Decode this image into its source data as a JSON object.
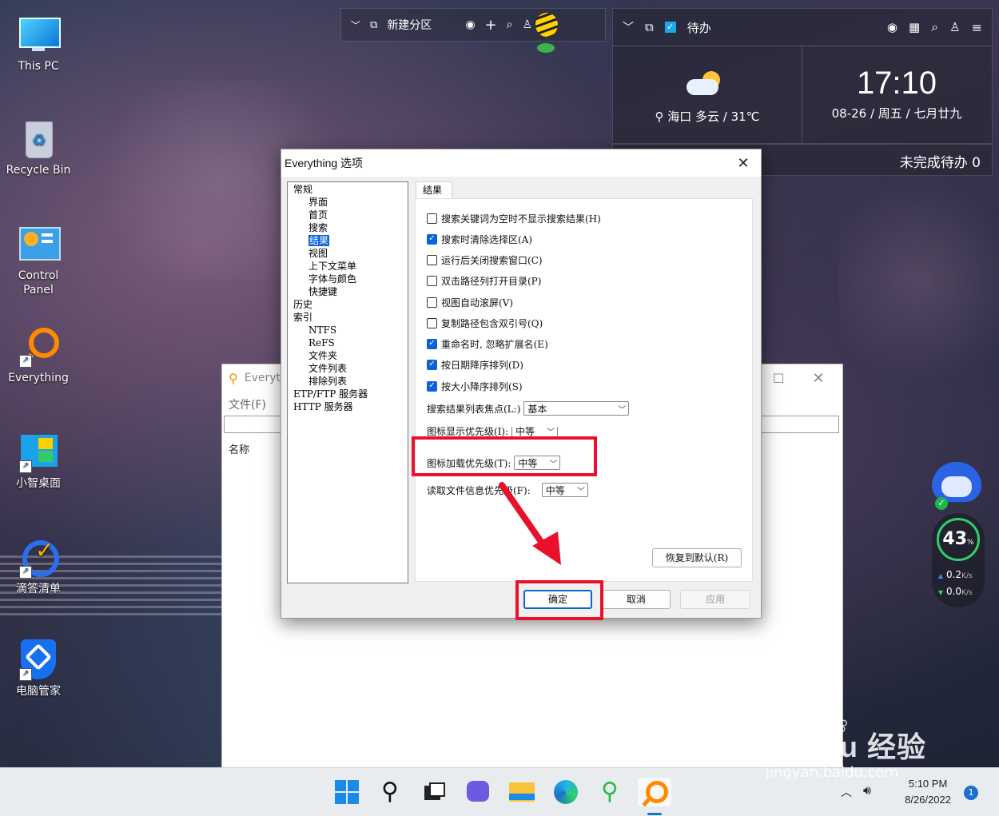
{
  "desktop_icons": [
    {
      "label": "This PC"
    },
    {
      "label": "Recycle Bin"
    },
    {
      "label": "Control Panel"
    },
    {
      "label": "Everything"
    },
    {
      "label": "小智桌面"
    },
    {
      "label": "滴答清单"
    },
    {
      "label": "电脑管家"
    }
  ],
  "widget_partition": {
    "title": "新建分区"
  },
  "widget_todo": {
    "title": "待办",
    "weather": "海口 多云 / 31℃",
    "time": "17:10",
    "date": "08-26 / 周五 / 七月廿九",
    "pending": "未完成待办 0"
  },
  "dialog": {
    "title": "Everything 选项",
    "tree": [
      {
        "label": "常规",
        "level": 1
      },
      {
        "label": "界面",
        "level": 2
      },
      {
        "label": "首页",
        "level": 2
      },
      {
        "label": "搜索",
        "level": 2
      },
      {
        "label": "结果",
        "level": 2,
        "selected": true
      },
      {
        "label": "视图",
        "level": 2
      },
      {
        "label": "上下文菜单",
        "level": 2
      },
      {
        "label": "字体与颜色",
        "level": 2
      },
      {
        "label": "快捷键",
        "level": 2
      },
      {
        "label": "历史",
        "level": 1
      },
      {
        "label": "索引",
        "level": 1
      },
      {
        "label": "NTFS",
        "level": 2
      },
      {
        "label": "ReFS",
        "level": 2
      },
      {
        "label": "文件夹",
        "level": 2
      },
      {
        "label": "文件列表",
        "level": 2
      },
      {
        "label": "排除列表",
        "level": 2
      },
      {
        "label": "ETP/FTP 服务器",
        "level": 1
      },
      {
        "label": "HTTP 服务器",
        "level": 1
      }
    ],
    "tab": "结果",
    "options": [
      {
        "label": "搜索关键词为空时不显示搜索结果(H)",
        "checked": false
      },
      {
        "label": "搜索时清除选择区(A)",
        "checked": true
      },
      {
        "label": "运行后关闭搜索窗口(C)",
        "checked": false
      },
      {
        "label": "双击路径列打开目录(P)",
        "checked": false
      },
      {
        "label": "视图自动滚屏(V)",
        "checked": false
      },
      {
        "label": "复制路径包含双引号(Q)",
        "checked": false
      },
      {
        "label": "重命名时, 忽略扩展名(E)",
        "checked": true
      },
      {
        "label": "按日期降序排列(D)",
        "checked": true
      },
      {
        "label": "按大小降序排列(S)",
        "checked": true
      }
    ],
    "focus_label": "搜索结果列表焦点(L:)",
    "focus_value": "基本",
    "icon_display_label": "图标显示优先级(I):",
    "icon_display_value": "中等",
    "icon_load_label": "图标加载优先级(T):",
    "icon_load_value": "中等",
    "file_info_label": "读取文件信息优先级(F):",
    "file_info_value": "中等",
    "restore_button": "恢复到默认(R)",
    "ok_button": "确定",
    "cancel_button": "取消",
    "apply_button": "应用"
  },
  "bg_window": {
    "title": "Everyt",
    "menu_file": "文件(F)",
    "col_name": "名称"
  },
  "tray": {
    "percent": "43",
    "percent_unit": "%",
    "up": "0.2",
    "down": "0.0",
    "speed_unit": "K/s"
  },
  "taskbar": {
    "time": "5:10 PM",
    "date": "8/26/2022",
    "badge": "1"
  },
  "watermark": {
    "text": "Bai du 经验",
    "url": "jingyan.baidu.com"
  },
  "colors": {
    "accent": "#0a64d8",
    "highlight": "#e8102a"
  }
}
